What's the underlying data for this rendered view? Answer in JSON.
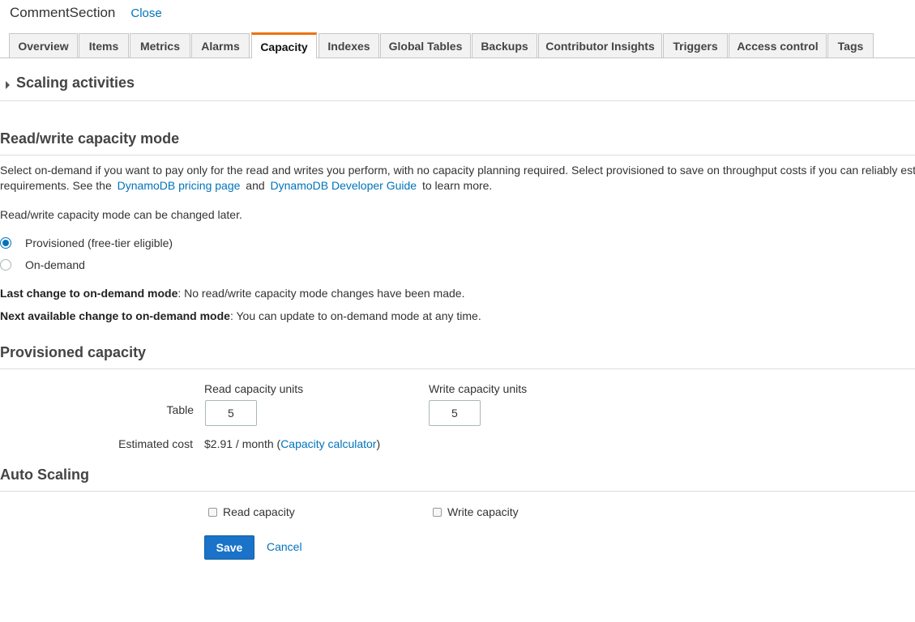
{
  "header": {
    "title": "CommentSection",
    "close_label": "Close"
  },
  "tabs": [
    {
      "label": "Overview",
      "active": false
    },
    {
      "label": "Items",
      "active": false
    },
    {
      "label": "Metrics",
      "active": false
    },
    {
      "label": "Alarms",
      "active": false
    },
    {
      "label": "Capacity",
      "active": true
    },
    {
      "label": "Indexes",
      "active": false
    },
    {
      "label": "Global Tables",
      "active": false
    },
    {
      "label": "Backups",
      "active": false
    },
    {
      "label": "Contributor Insights",
      "active": false
    },
    {
      "label": "Triggers",
      "active": false
    },
    {
      "label": "Access control",
      "active": false
    },
    {
      "label": "Tags",
      "active": false
    }
  ],
  "scaling_activities": {
    "label": "Scaling activities",
    "icon": "caret-right-icon"
  },
  "mode_section": {
    "title": "Read/write capacity mode",
    "description_line1": "Select on-demand if you want to pay only for the read and writes you perform, with no capacity planning required. Select provisioned to save on throughput costs if you can reliably est",
    "description_line2_prefix": "requirements. See the",
    "pricing_link": "DynamoDB pricing page",
    "and_text": "and",
    "guide_link": "DynamoDB Developer Guide",
    "description_line2_suffix": "to learn more.",
    "change_note": "Read/write capacity mode can be changed later.",
    "options": [
      {
        "label": "Provisioned (free-tier eligible)",
        "checked": true
      },
      {
        "label": "On-demand",
        "checked": false
      }
    ],
    "last_change_label": "Last change to on-demand mode",
    "last_change_text": ": No read/write capacity mode changes have been made.",
    "next_change_label": "Next available change to on-demand mode",
    "next_change_text": ": You can update to on-demand mode at any time."
  },
  "provisioned": {
    "title": "Provisioned capacity",
    "read_header": "Read capacity units",
    "write_header": "Write capacity units",
    "table_label": "Table",
    "read_value": "5",
    "write_value": "5",
    "estimated_cost_label": "Estimated cost",
    "cost_value": "$2.91 / month",
    "paren_open": "(",
    "calculator_link": "Capacity calculator",
    "paren_close": ")"
  },
  "auto_scaling": {
    "title": "Auto Scaling",
    "read_label": "Read capacity",
    "write_label": "Write capacity",
    "read_checked": false,
    "write_checked": false
  },
  "actions": {
    "save_label": "Save",
    "cancel_label": "Cancel"
  },
  "colors": {
    "link": "#0073bb",
    "primary_button": "#1a73c8",
    "active_tab_accent": "#ec7211"
  }
}
